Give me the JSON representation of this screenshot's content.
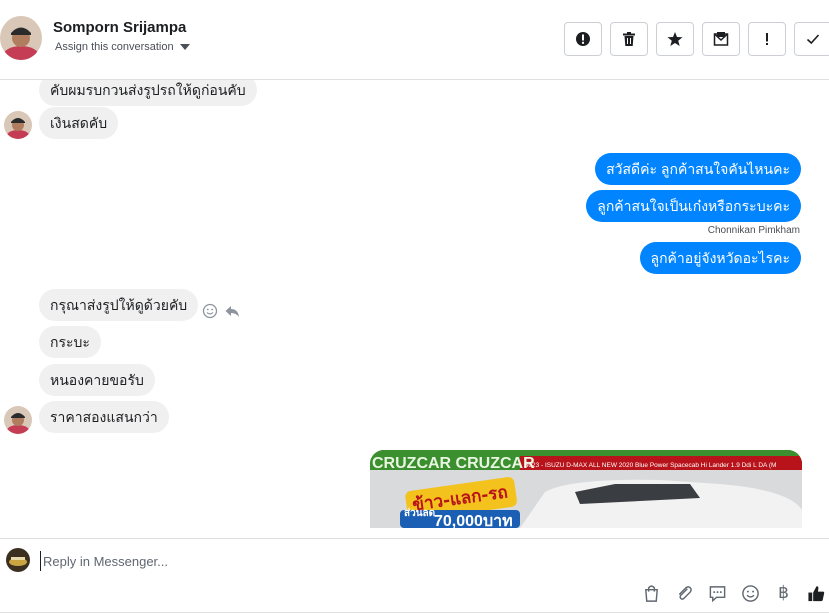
{
  "header": {
    "name": "Somporn Srijampa",
    "assign_label": "Assign this conversation"
  },
  "toolbar": {
    "icons": [
      "alert-circle-icon",
      "trash-icon",
      "star-icon",
      "envelope-icon",
      "exclamation-icon",
      "check-icon"
    ]
  },
  "messages": {
    "m1": "คับผมรบกวนส่งรูปรถให้ดูก่อนคับ",
    "m2": "เงินสดคับ",
    "m3": "สวัสดีค่ะ ลูกค้าสนใจคันไหนคะ",
    "m4": "ลูกค้าสนใจเป็นเก๋งหรือกระบะคะ",
    "m4_sender": "Chonnikan Pimkham",
    "m5": "ลูกค้าอยู่จังหวัดอะไรคะ",
    "m6": "กรุณาส่งรูปให้ดูด้วยคับ",
    "m7": "กระบะ",
    "m8": "หนองคายขอรับ",
    "m9": "ราคาสองแสนกว่า"
  },
  "card": {
    "banner_text": "CRUZCAR CRUZCAR",
    "caption": "B023 - ISUZU D-MAX ALL NEW 2020 Blue Power Spacecab Hi Lander 1.9 Ddi L DA (M",
    "promo": "ข้าว-แลก-รถ",
    "discount_label": "ส่วนลด",
    "discount_value": "70,000บาท"
  },
  "composer": {
    "placeholder": "Reply in Messenger..."
  },
  "colors": {
    "outgoing_bubble": "#0084ff",
    "incoming_bubble": "#f1f0f0"
  }
}
